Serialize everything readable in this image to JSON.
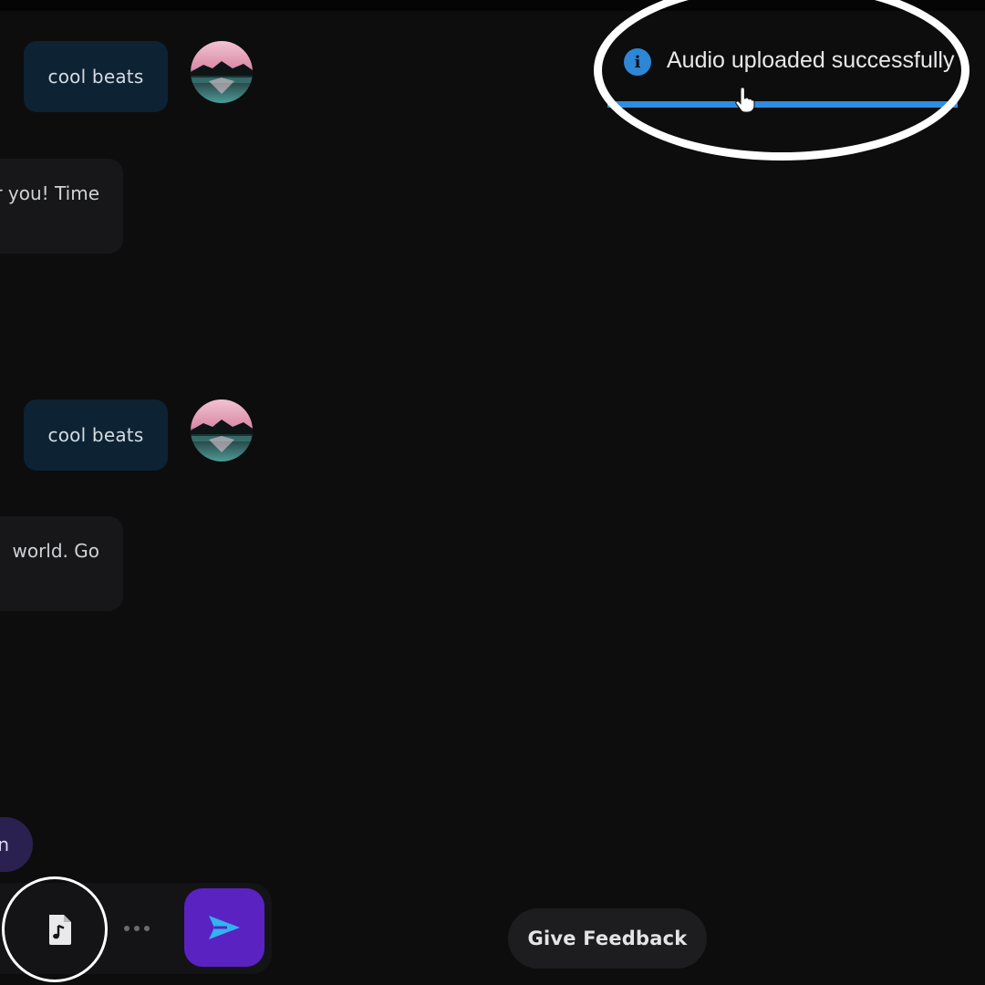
{
  "messages": [
    {
      "role": "user",
      "text": "cool beats"
    },
    {
      "role": "assistant",
      "text": "r you! Time"
    },
    {
      "role": "user",
      "text": "cool beats"
    },
    {
      "role": "assistant",
      "text": "world. Go"
    }
  ],
  "pill": {
    "label": "n"
  },
  "composer": {
    "audio_icon": "audio-file-icon",
    "more_icon": "more-dots-icon",
    "send_icon": "send-arrow-icon",
    "send_color": "#5b22c2"
  },
  "feedback": {
    "label": "Give Feedback"
  },
  "toast": {
    "message": "Audio uploaded successfully",
    "icon": "info-icon",
    "icon_glyph": "i",
    "progress": 1.0,
    "progress_color": "#2d8de0"
  }
}
